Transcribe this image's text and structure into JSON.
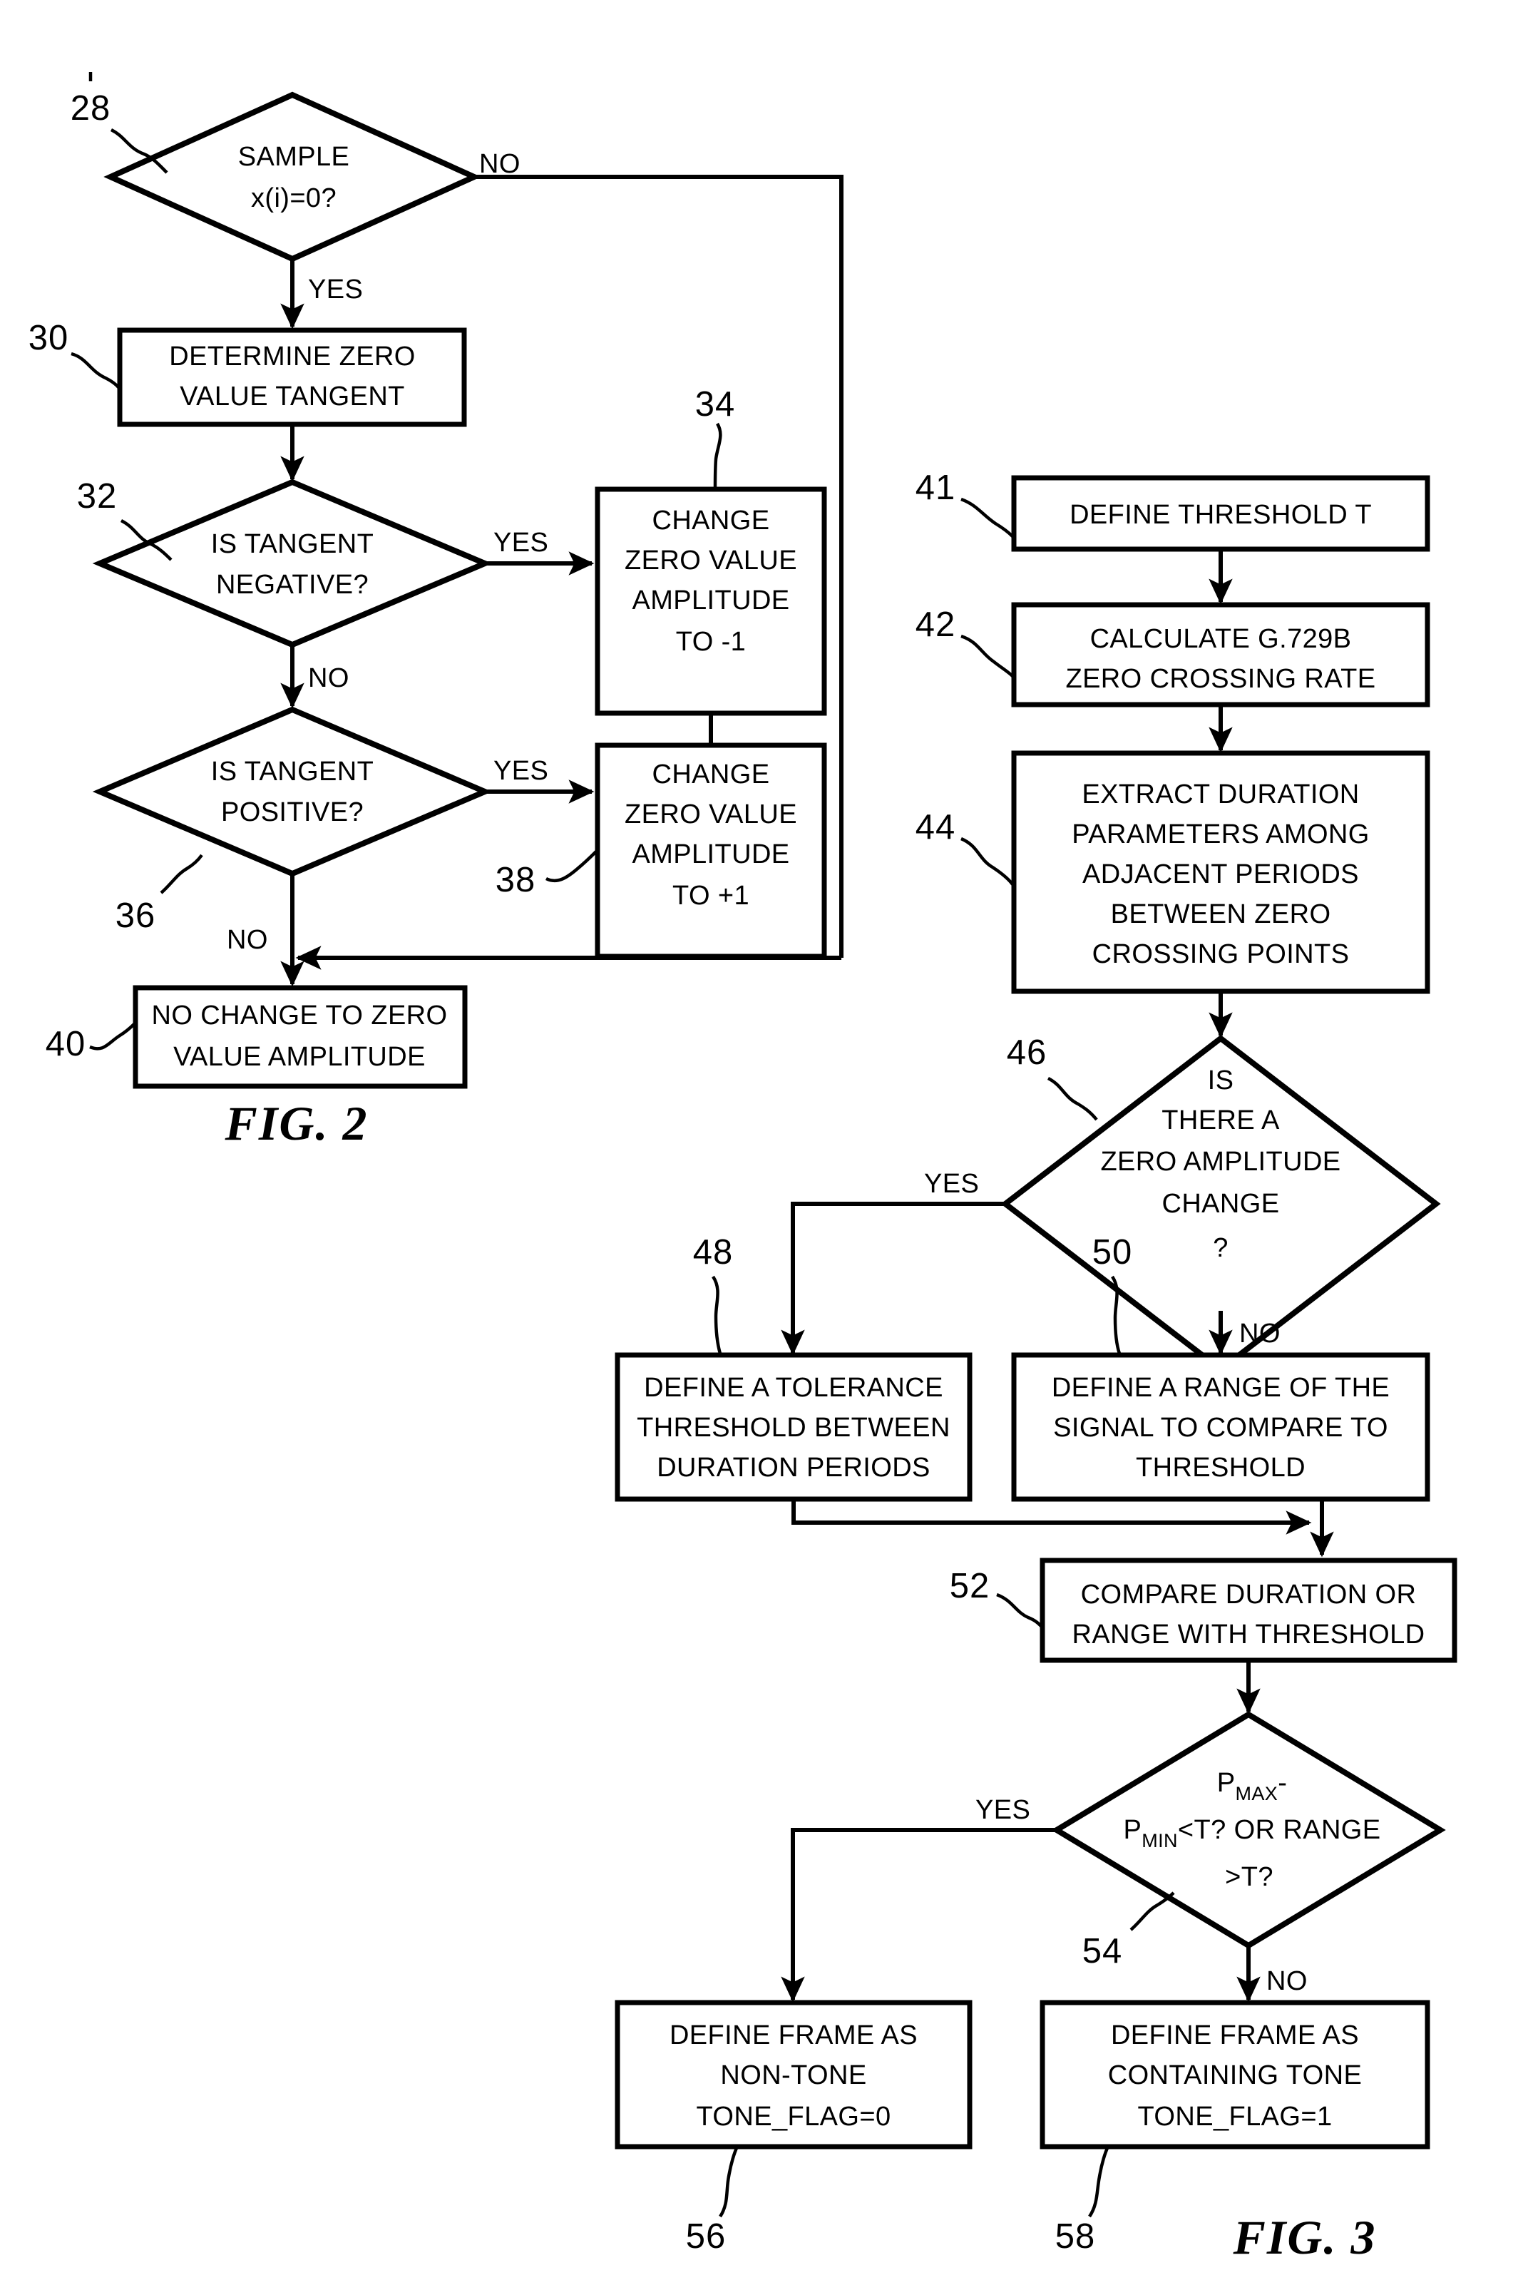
{
  "figures": [
    {
      "id": "fig2",
      "caption": "FIG. 2",
      "nodes": [
        {
          "ref": "28",
          "type": "decision",
          "lines": [
            "SAMPLE",
            "x(i)=0?"
          ]
        },
        {
          "ref": "30",
          "type": "process",
          "lines": [
            "DETERMINE ZERO",
            "VALUE TANGENT"
          ]
        },
        {
          "ref": "32",
          "type": "decision",
          "lines": [
            "IS TANGENT",
            "NEGATIVE?"
          ]
        },
        {
          "ref": "34",
          "type": "process",
          "lines": [
            "CHANGE",
            "ZERO VALUE",
            "AMPLITUDE",
            "TO -1"
          ]
        },
        {
          "ref": "36",
          "type": "decision",
          "lines": [
            "IS TANGENT",
            "POSITIVE?"
          ]
        },
        {
          "ref": "38",
          "type": "process",
          "lines": [
            "CHANGE",
            "ZERO VALUE",
            "AMPLITUDE",
            "TO +1"
          ]
        },
        {
          "ref": "40",
          "type": "process",
          "lines": [
            "NO CHANGE TO ZERO",
            "VALUE AMPLITUDE"
          ]
        }
      ],
      "branch_labels": [
        {
          "id": "f2-28-no",
          "text": "NO"
        },
        {
          "id": "f2-28-yes",
          "text": "YES"
        },
        {
          "id": "f2-32-yes",
          "text": "YES"
        },
        {
          "id": "f2-32-no",
          "text": "NO"
        },
        {
          "id": "f2-36-yes",
          "text": "YES"
        },
        {
          "id": "f2-36-no",
          "text": "NO"
        }
      ]
    },
    {
      "id": "fig3",
      "caption": "FIG. 3",
      "nodes": [
        {
          "ref": "41",
          "type": "process",
          "lines": [
            "DEFINE THRESHOLD T"
          ]
        },
        {
          "ref": "42",
          "type": "process",
          "lines": [
            "CALCULATE G.729B",
            "ZERO CROSSING RATE"
          ]
        },
        {
          "ref": "44",
          "type": "process",
          "lines": [
            "EXTRACT DURATION",
            "PARAMETERS AMONG",
            "ADJACENT PERIODS",
            "BETWEEN ZERO",
            "CROSSING POINTS"
          ]
        },
        {
          "ref": "46",
          "type": "decision",
          "lines": [
            "IS",
            "THERE A",
            "ZERO AMPLITUDE",
            "CHANGE",
            "?"
          ]
        },
        {
          "ref": "48",
          "type": "process",
          "lines": [
            "DEFINE A TOLERANCE",
            "THRESHOLD BETWEEN",
            "DURATION PERIODS"
          ]
        },
        {
          "ref": "50",
          "type": "process",
          "lines": [
            "DEFINE A RANGE OF THE",
            "SIGNAL TO COMPARE TO",
            "THRESHOLD"
          ]
        },
        {
          "ref": "52",
          "type": "process",
          "lines": [
            "COMPARE DURATION OR",
            "RANGE WITH THRESHOLD"
          ]
        },
        {
          "ref": "54",
          "type": "decision",
          "lines": [
            "P MAX -",
            "P MIN <T? OR RANGE",
            ">T?"
          ],
          "formula": {
            "line1_base": "P",
            "line1_sub": "MAX",
            "line1_tail": "-",
            "line2_base": "P",
            "line2_sub": "MIN",
            "line2_tail": "<T? OR RANGE",
            "line3": ">T?"
          }
        },
        {
          "ref": "56",
          "type": "process",
          "lines": [
            "DEFINE FRAME AS",
            "NON-TONE",
            "TONE_FLAG=0"
          ]
        },
        {
          "ref": "58",
          "type": "process",
          "lines": [
            "DEFINE FRAME AS",
            "CONTAINING TONE",
            "TONE_FLAG=1"
          ]
        }
      ],
      "branch_labels": [
        {
          "id": "f3-46-yes",
          "text": "YES"
        },
        {
          "id": "f3-46-no",
          "text": "NO"
        },
        {
          "id": "f3-54-yes",
          "text": "YES"
        },
        {
          "id": "f3-54-no",
          "text": "NO"
        }
      ]
    }
  ]
}
